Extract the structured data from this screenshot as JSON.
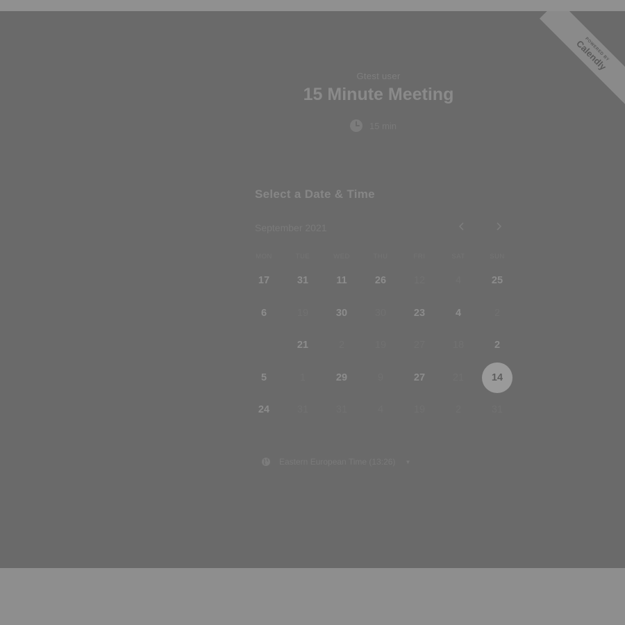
{
  "header": {
    "owner": "Gtest user",
    "title": "15 Minute Meeting",
    "duration": "15 min"
  },
  "ribbon": {
    "powered_by": "POWERED BY",
    "brand": "Calendly"
  },
  "calendar": {
    "heading": "Select a Date & Time",
    "month": "September 2021",
    "prev_icon": "chevron-left-icon",
    "next_icon": "chevron-right-icon",
    "weekdays": [
      "MON",
      "TUE",
      "WED",
      "THU",
      "FRI",
      "SAT",
      "SUN"
    ],
    "days": [
      {
        "label": "17",
        "state": "available"
      },
      {
        "label": "31",
        "state": "available"
      },
      {
        "label": "11",
        "state": "available"
      },
      {
        "label": "26",
        "state": "available"
      },
      {
        "label": "12",
        "state": "unavailable"
      },
      {
        "label": "4",
        "state": "unavailable"
      },
      {
        "label": "25",
        "state": "available"
      },
      {
        "label": "6",
        "state": "available"
      },
      {
        "label": "19",
        "state": "unavailable"
      },
      {
        "label": "30",
        "state": "available"
      },
      {
        "label": "30",
        "state": "unavailable"
      },
      {
        "label": "23",
        "state": "available"
      },
      {
        "label": "4",
        "state": "available"
      },
      {
        "label": "2",
        "state": "unavailable"
      },
      {
        "label": "",
        "state": "unavailable"
      },
      {
        "label": "21",
        "state": "available"
      },
      {
        "label": "2",
        "state": "unavailable"
      },
      {
        "label": "19",
        "state": "unavailable"
      },
      {
        "label": "27",
        "state": "unavailable"
      },
      {
        "label": "18",
        "state": "unavailable"
      },
      {
        "label": "2",
        "state": "available"
      },
      {
        "label": "5",
        "state": "available"
      },
      {
        "label": "1",
        "state": "unavailable"
      },
      {
        "label": "29",
        "state": "available"
      },
      {
        "label": "9",
        "state": "unavailable"
      },
      {
        "label": "27",
        "state": "available"
      },
      {
        "label": "21",
        "state": "unavailable"
      },
      {
        "label": "14",
        "state": "selected"
      },
      {
        "label": "24",
        "state": "available"
      },
      {
        "label": "31",
        "state": "unavailable"
      },
      {
        "label": "31",
        "state": "unavailable"
      },
      {
        "label": "4",
        "state": "unavailable"
      },
      {
        "label": "19",
        "state": "unavailable"
      },
      {
        "label": "2",
        "state": "unavailable"
      },
      {
        "label": "31",
        "state": "unavailable"
      }
    ]
  },
  "timezone": {
    "label": "Eastern European Time (13:26)",
    "icon": "globe-icon"
  },
  "colors": {
    "panel": "#6a6a6a",
    "selected_day": "#9a9a9a"
  }
}
